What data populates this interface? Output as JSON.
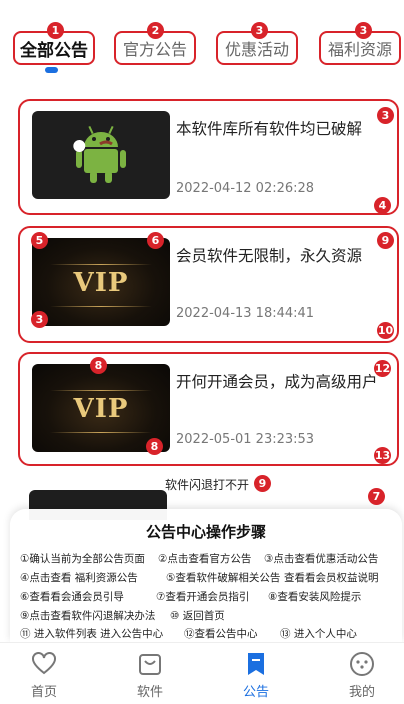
{
  "tabs": [
    {
      "label": "全部公告",
      "badge": "1",
      "active": true
    },
    {
      "label": "官方公告",
      "badge": "2",
      "active": false
    },
    {
      "label": "优惠活动",
      "badge": "3",
      "active": false
    },
    {
      "label": "福利资源",
      "badge": "3",
      "active": false
    }
  ],
  "cards": [
    {
      "title": "本软件库所有软件均已破解",
      "date": "2022-04-12 02:26:28",
      "thumb_icon": "android-icon",
      "badges": [
        "3",
        "4"
      ]
    },
    {
      "title": "会员软件无限制，永久资源",
      "date": "2022-04-13 18:44:41",
      "thumb_text": "VIP",
      "badges": [
        "5",
        "6",
        "3",
        "9",
        "10"
      ]
    },
    {
      "title": "开何开通会员，成为高级用户",
      "date": "2022-05-01 23:23:53",
      "thumb_text": "VIP",
      "badges": [
        "8",
        "8",
        "12",
        "13"
      ]
    }
  ],
  "cutoff_text": "软件闪退打不开",
  "cutoff_badge": "9",
  "partial_card_badge": "7",
  "guide": {
    "title": "公告中心操作步骤",
    "steps": [
      "①确认当前为全部公告页面",
      "②点击查看官方公告",
      "③点击查看优惠活动公告",
      "④点击查看 福利资源公告",
      "⑤查看软件破解相关公告",
      "查看看会员权益说明",
      "⑥查看看会通会员引导",
      "⑦查看开通会员指引",
      "⑧查看安装风险提示",
      "⑨点击查看软件闪退解决办法",
      "⑩ 返回首页",
      "⑪ 进入软件列表  进入公告中心",
      "⑫查看公告中心",
      "⑬ 进入个人中心"
    ]
  },
  "nav": [
    {
      "label": "首页",
      "icon": "heart-icon",
      "active": false
    },
    {
      "label": "软件",
      "icon": "bag-icon",
      "active": false
    },
    {
      "label": "公告",
      "icon": "bookmark-icon",
      "active": true
    },
    {
      "label": "我的",
      "icon": "smile-icon",
      "active": false
    }
  ],
  "colors": {
    "accent": "#1b6fe0",
    "annotation": "#d8232a"
  }
}
